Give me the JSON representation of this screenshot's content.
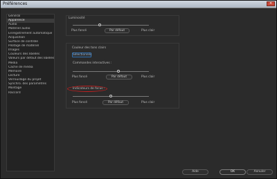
{
  "window": {
    "title": "Préférences"
  },
  "sidebar": {
    "items": [
      {
        "label": "Général"
      },
      {
        "label": "Apparence"
      },
      {
        "label": "Audio"
      },
      {
        "label": "Matériel audio"
      },
      {
        "label": "Enregistrement automatique"
      },
      {
        "label": "Acquisition"
      },
      {
        "label": "Surface de contrôle"
      },
      {
        "label": "Pilotage de matériel"
      },
      {
        "label": "Images"
      },
      {
        "label": "Couleurs des libellés"
      },
      {
        "label": "Valeurs par défaut des libellés"
      },
      {
        "label": "Média"
      },
      {
        "label": "Cache de média"
      },
      {
        "label": "Mémoire"
      },
      {
        "label": "Lecture"
      },
      {
        "label": "Verrouillage du projet"
      },
      {
        "label": "Synchro. des paramètres"
      },
      {
        "label": "Montage"
      },
      {
        "label": "Raccord"
      }
    ],
    "selected_index": 1
  },
  "brightness": {
    "title": "Luminosité",
    "darker": "Plus foncé",
    "default_button": "Par défaut",
    "lighter": "Plus clair",
    "value": 0.35
  },
  "light_colors": {
    "title": "Couleur des tons clairs",
    "swatch_label": "Sélectionnés",
    "interactive_title": "Commandes interactives :",
    "interactive_darker": "Plus foncé",
    "interactive_default": "Par défaut",
    "interactive_lighter": "Plus clair",
    "interactive_value": 0.6,
    "focus_title": "Indicateurs de focus :",
    "focus_darker": "Plus foncé",
    "focus_default": "Par défaut",
    "focus_lighter": "Plus clair",
    "focus_value": 0.5
  },
  "footer": {
    "help": "Aide",
    "ok": "OK",
    "cancel": "Annuler"
  }
}
